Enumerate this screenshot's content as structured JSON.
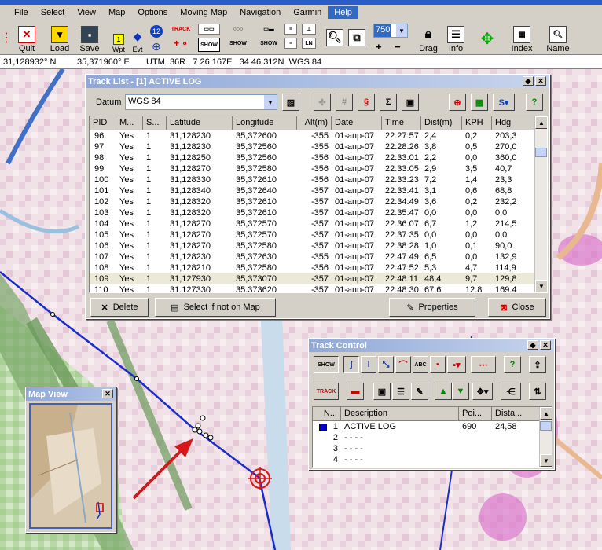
{
  "menu": [
    "File",
    "Select",
    "View",
    "Map",
    "Options",
    "Moving Map",
    "Navigation",
    "Garmin",
    "Help"
  ],
  "toolbar": {
    "quit": "Quit",
    "load": "Load",
    "save": "Save",
    "wpt": "Wpt",
    "evt": "Evt",
    "count": "12",
    "track_small": "TRACK",
    "show_small": "SHOW",
    "zoom_value": "750",
    "drag": "Drag",
    "info": "Info",
    "index": "Index",
    "name": "Name",
    "plus": "+",
    "minus": "−"
  },
  "coords": {
    "lat": "31,128932° N",
    "lon": "35,371960° E",
    "utm": "UTM  36R   7 26 167E   34 46 312N  WGS 84"
  },
  "track_list": {
    "title": "Track List - [1] ACTIVE LOG",
    "datum_label": "Datum",
    "datum_value": "WGS 84",
    "columns": [
      "PID",
      "M...",
      "S...",
      "Latitude",
      "Longitude",
      "Alt(m)",
      "Date",
      "Time",
      "Dist(m)",
      "KPH",
      "Hdg"
    ],
    "rows": [
      [
        "96",
        "Yes",
        "1",
        "31,128230",
        "35,372600",
        "-355",
        "01-апр-07",
        "22:27:57",
        "2,4",
        "0,2",
        "203,3"
      ],
      [
        "97",
        "Yes",
        "1",
        "31,128230",
        "35,372560",
        "-355",
        "01-апр-07",
        "22:28:26",
        "3,8",
        "0,5",
        "270,0"
      ],
      [
        "98",
        "Yes",
        "1",
        "31,128250",
        "35,372560",
        "-356",
        "01-апр-07",
        "22:33:01",
        "2,2",
        "0,0",
        "360,0"
      ],
      [
        "99",
        "Yes",
        "1",
        "31,128270",
        "35,372580",
        "-356",
        "01-апр-07",
        "22:33:05",
        "2,9",
        "3,5",
        "40,7"
      ],
      [
        "100",
        "Yes",
        "1",
        "31,128330",
        "35,372610",
        "-356",
        "01-апр-07",
        "22:33:23",
        "7,2",
        "1,4",
        "23,3"
      ],
      [
        "101",
        "Yes",
        "1",
        "31,128340",
        "35,372640",
        "-357",
        "01-апр-07",
        "22:33:41",
        "3,1",
        "0,6",
        "68,8"
      ],
      [
        "102",
        "Yes",
        "1",
        "31,128320",
        "35,372610",
        "-357",
        "01-апр-07",
        "22:34:49",
        "3,6",
        "0,2",
        "232,2"
      ],
      [
        "103",
        "Yes",
        "1",
        "31,128320",
        "35,372610",
        "-357",
        "01-апр-07",
        "22:35:47",
        "0,0",
        "0,0",
        "0,0"
      ],
      [
        "104",
        "Yes",
        "1",
        "31,128270",
        "35,372570",
        "-357",
        "01-апр-07",
        "22:36:07",
        "6,7",
        "1,2",
        "214,5"
      ],
      [
        "105",
        "Yes",
        "1",
        "31,128270",
        "35,372570",
        "-357",
        "01-апр-07",
        "22:37:35",
        "0,0",
        "0,0",
        "0,0"
      ],
      [
        "106",
        "Yes",
        "1",
        "31,128270",
        "35,372580",
        "-357",
        "01-апр-07",
        "22:38:28",
        "1,0",
        "0,1",
        "90,0"
      ],
      [
        "107",
        "Yes",
        "1",
        "31,128230",
        "35,372630",
        "-355",
        "01-апр-07",
        "22:47:49",
        "6,5",
        "0,0",
        "132,9"
      ],
      [
        "108",
        "Yes",
        "1",
        "31,128210",
        "35,372580",
        "-356",
        "01-апр-07",
        "22:47:52",
        "5,3",
        "4,7",
        "114,9"
      ],
      [
        "109",
        "Yes",
        "1",
        "31,127930",
        "35,373070",
        "-357",
        "01-апр-07",
        "22:48:11",
        "48,4",
        "9,7",
        "129,8"
      ],
      [
        "110",
        "Yes",
        "1",
        "31,127330",
        "35,373620",
        "-357",
        "01-апр-07",
        "22:48:30",
        "67,6",
        "12,8",
        "169,4"
      ]
    ],
    "selected_row": 13,
    "delete_label": "Delete",
    "select_label": "Select if not on Map",
    "properties_label": "Properties",
    "close_label": "Close"
  },
  "track_control": {
    "title": "Track Control",
    "show_small": "SHOW",
    "abc_small": "ABC",
    "track_small": "TRACK",
    "columns": [
      "N...",
      "Description",
      "Poi...",
      "Dista..."
    ],
    "rows": [
      {
        "n": "1",
        "desc": "ACTIVE LOG",
        "points": "690",
        "dist": "24,58"
      },
      {
        "n": "2",
        "desc": "- - - -",
        "points": "",
        "dist": ""
      },
      {
        "n": "3",
        "desc": "- - - -",
        "points": "",
        "dist": ""
      },
      {
        "n": "4",
        "desc": "- - - -",
        "points": "",
        "dist": ""
      }
    ]
  },
  "map_view": {
    "title": "Map View"
  },
  "colors": {
    "track_line": "#1c2cc8",
    "highlight": "#316ac5",
    "arrow": "#d81818"
  }
}
